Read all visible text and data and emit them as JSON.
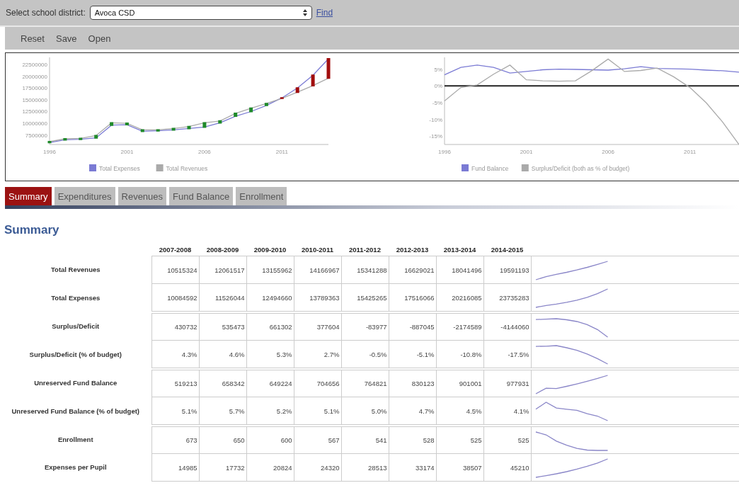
{
  "district_bar": {
    "label": "Select school district:",
    "select_value": "Avoca CSD",
    "find_link": "Find"
  },
  "toolbar": [
    "Reset",
    "Save",
    "Open"
  ],
  "charts": [
    {
      "chart_data": {
        "type": "line",
        "legend": "bottom",
        "x": [
          1996,
          1997,
          1998,
          1999,
          2000,
          2001,
          2002,
          2003,
          2004,
          2005,
          2006,
          2007,
          2008,
          2009,
          2010,
          2011,
          2012,
          2013,
          2014
        ],
        "xticks": [
          1996,
          2001,
          2006,
          2011
        ],
        "xlim": [
          1996,
          2014
        ],
        "ylim": [
          5500000,
          24000000
        ],
        "yticks": [
          7500000,
          10000000,
          12500000,
          15000000,
          17500000,
          20000000,
          22500000
        ],
        "series": [
          {
            "name": "Total Expenses",
            "color": "#7b7bd4",
            "values": [
              5900000,
              6500000,
              6600000,
              6900000,
              9600000,
              9700000,
              8300000,
              8400000,
              8600000,
              8900000,
              9200000,
              10100000,
              11500000,
              12500000,
              13800000,
              15400000,
              17500000,
              20200000,
              23700000
            ]
          },
          {
            "name": "Total Revenues",
            "color": "#aaaaaa",
            "values": [
              6100000,
              6700000,
              6800000,
              7400000,
              10100000,
              10000000,
              8600000,
              8600000,
              8900000,
              9300000,
              10100000,
              10500000,
              12100000,
              13200000,
              14200000,
              15300000,
              16600000,
              18000000,
              19600000
            ]
          }
        ]
      }
    },
    {
      "chart_data": {
        "type": "line",
        "legend": "bottom",
        "x": [
          1996,
          1997,
          1998,
          1999,
          2000,
          2001,
          2002,
          2003,
          2004,
          2005,
          2006,
          2007,
          2008,
          2009,
          2010,
          2011,
          2012,
          2013,
          2014
        ],
        "xticks": [
          1996,
          2001,
          2006,
          2011
        ],
        "xlim": [
          1996,
          2014
        ],
        "ylim": [
          -17.5,
          8.5
        ],
        "yticks": [
          {
            "value": 5,
            "label": "5%"
          },
          {
            "value": 0,
            "label": "0%"
          },
          {
            "value": -5,
            "label": "-5%"
          },
          {
            "value": -10,
            "label": "-10%"
          },
          {
            "value": -15,
            "label": "-15%"
          }
        ],
        "series": [
          {
            "name": "Fund Balance",
            "color": "#7b7bd4",
            "values": [
              3.3,
              5.5,
              6.2,
              5.5,
              3.8,
              4.3,
              4.8,
              5,
              4.9,
              4.8,
              4.7,
              5.1,
              5.7,
              5.2,
              5.1,
              5.0,
              4.7,
              4.5,
              4.1
            ]
          },
          {
            "name": "Surplus/Deficit (both as % of budget)",
            "color": "#aaaaaa",
            "values": [
              -4.5,
              -0.5,
              0.3,
              3.5,
              6.2,
              1.8,
              1.5,
              1.4,
              1.5,
              4.5,
              8.0,
              4.3,
              4.6,
              5.3,
              2.7,
              -0.5,
              -5.1,
              -10.8,
              -17.5
            ]
          }
        ]
      }
    }
  ],
  "tabs": [
    {
      "label": "Summary",
      "selected": true
    },
    {
      "label": "Expenditures",
      "selected": false
    },
    {
      "label": "Revenues",
      "selected": false
    },
    {
      "label": "Fund Balance",
      "selected": false
    },
    {
      "label": "Enrollment",
      "selected": false
    }
  ],
  "section_title": "Summary",
  "table": {
    "columns": [
      "2007-2008",
      "2008-2009",
      "2009-2010",
      "2010-2011",
      "2011-2012",
      "2012-2013",
      "2013-2014",
      "2014-2015"
    ],
    "rows": [
      {
        "label": "Total Revenues",
        "divider_before": false,
        "values": [
          "10515324",
          "12061517",
          "13155962",
          "14166967",
          "15341288",
          "16629021",
          "18041496",
          "19591193"
        ]
      },
      {
        "label": "Total Expenses",
        "divider_before": false,
        "values": [
          "10084592",
          "11526044",
          "12494660",
          "13789363",
          "15425265",
          "17516066",
          "20216085",
          "23735283"
        ]
      },
      {
        "label": "Surplus/Deficit",
        "divider_before": true,
        "values": [
          "430732",
          "535473",
          "661302",
          "377604",
          "-83977",
          "-887045",
          "-2174589",
          "-4144060"
        ]
      },
      {
        "label": "Surplus/Deficit (% of budget)",
        "divider_before": false,
        "values": [
          "4.3%",
          "4.6%",
          "5.3%",
          "2.7%",
          "-0.5%",
          "-5.1%",
          "-10.8%",
          "-17.5%"
        ]
      },
      {
        "label": "Unreserved Fund Balance",
        "divider_before": true,
        "values": [
          "519213",
          "658342",
          "649224",
          "704656",
          "764821",
          "830123",
          "901001",
          "977931"
        ]
      },
      {
        "label": "Unreserved Fund Balance (% of budget)",
        "divider_before": false,
        "values": [
          "5.1%",
          "5.7%",
          "5.2%",
          "5.1%",
          "5.0%",
          "4.7%",
          "4.5%",
          "4.1%"
        ]
      },
      {
        "label": "Enrollment",
        "divider_before": true,
        "values": [
          "673",
          "650",
          "600",
          "567",
          "541",
          "528",
          "525",
          "525"
        ]
      },
      {
        "label": "Expenses per Pupil",
        "divider_before": false,
        "values": [
          "14985",
          "17732",
          "20824",
          "24320",
          "28513",
          "33174",
          "38507",
          "45210"
        ]
      }
    ]
  }
}
